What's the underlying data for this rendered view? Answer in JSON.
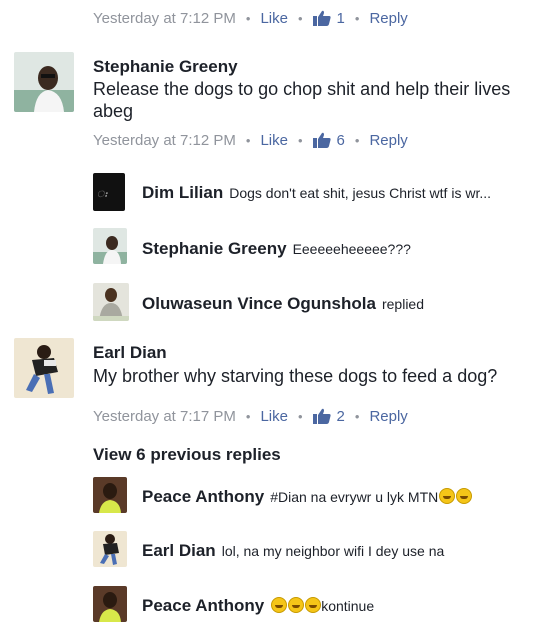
{
  "top_meta": {
    "time": "Yesterday at 7:12 PM",
    "like": "Like",
    "count": "1",
    "reply": "Reply"
  },
  "comment1": {
    "name": "Stephanie Greeny",
    "text": "Release the dogs to go chop shit and help their lives abeg",
    "meta": {
      "time": "Yesterday at 7:12 PM",
      "like": "Like",
      "count": "6",
      "reply": "Reply"
    },
    "replies": [
      {
        "name": "Dim Lilian",
        "text": "Dogs don't eat shit, jesus Christ wtf is wr..."
      },
      {
        "name": "Stephanie Greeny",
        "text": "Eeeeeeheeeee???"
      },
      {
        "name": "Oluwaseun Vince Ogunshola",
        "text": "replied"
      }
    ]
  },
  "comment2": {
    "name": "Earl Dian",
    "text": "My brother why starving these dogs to feed a dog?",
    "meta": {
      "time": "Yesterday at 7:17 PM",
      "like": "Like",
      "count": "2",
      "reply": "Reply"
    },
    "view_previous": "View 6 previous replies",
    "replies": [
      {
        "name": "Peace Anthony",
        "text": "#Dian na evrywr u lyk MTN"
      },
      {
        "name": "Earl Dian",
        "text": "lol, na my neighbor wifi I dey use na"
      },
      {
        "name": "Peace Anthony",
        "text": "kontinue"
      }
    ]
  },
  "dot": "•",
  "icons": {
    "like": "thumbs-up-icon",
    "laugh": "laughing-emoji-icon"
  },
  "colors": {
    "link": "#4b67a1",
    "meta": "#90949c",
    "text": "#1d2129"
  }
}
